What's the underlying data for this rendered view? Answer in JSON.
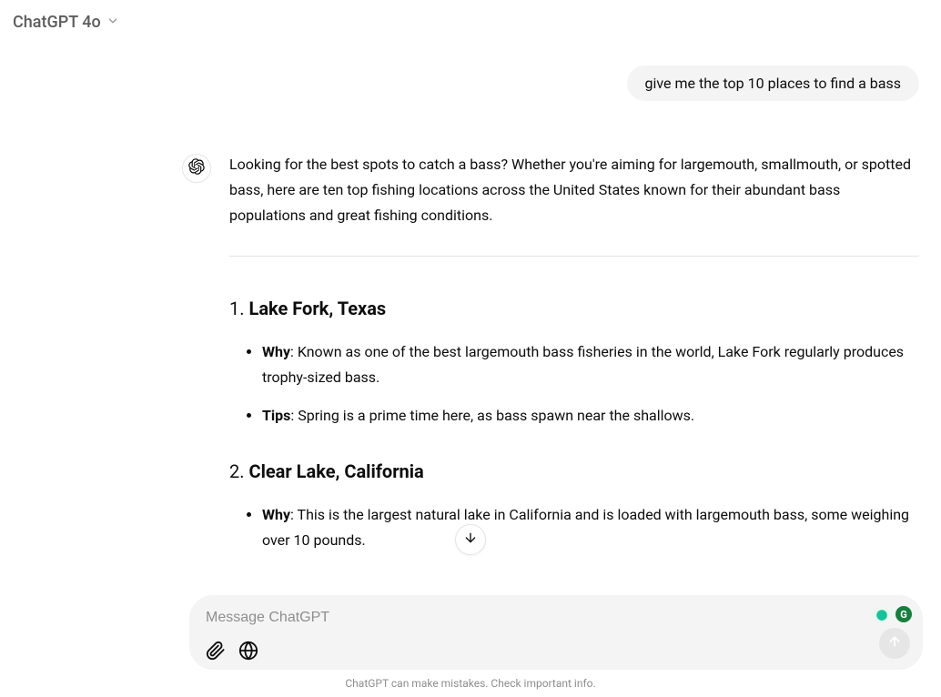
{
  "header": {
    "model_label": "ChatGPT 4o"
  },
  "conversation": {
    "user_message": "give me the top 10 places to find a bass",
    "assistant_intro": "Looking for the best spots to catch a bass? Whether you're aiming for largemouth, smallmouth, or spotted bass, here are ten top fishing locations across the United States known for their abundant bass populations and great fishing conditions.",
    "items": [
      {
        "num": "1.",
        "name": "Lake Fork, Texas",
        "why_label": "Why",
        "why_text": ": Known as one of the best largemouth bass fisheries in the world, Lake Fork regularly produces trophy-sized bass.",
        "tips_label": "Tips",
        "tips_text": ": Spring is a prime time here, as bass spawn near the shallows."
      },
      {
        "num": "2.",
        "name": "Clear Lake, California",
        "why_label": "Why",
        "why_text": ": This is the largest natural lake in California and is loaded with largemouth bass, some weighing over 10 pounds.",
        "tips_label": "",
        "tips_text": ""
      }
    ]
  },
  "composer": {
    "placeholder": "Message ChatGPT"
  },
  "footer": {
    "text": "ChatGPT can make mistakes. Check important info."
  }
}
